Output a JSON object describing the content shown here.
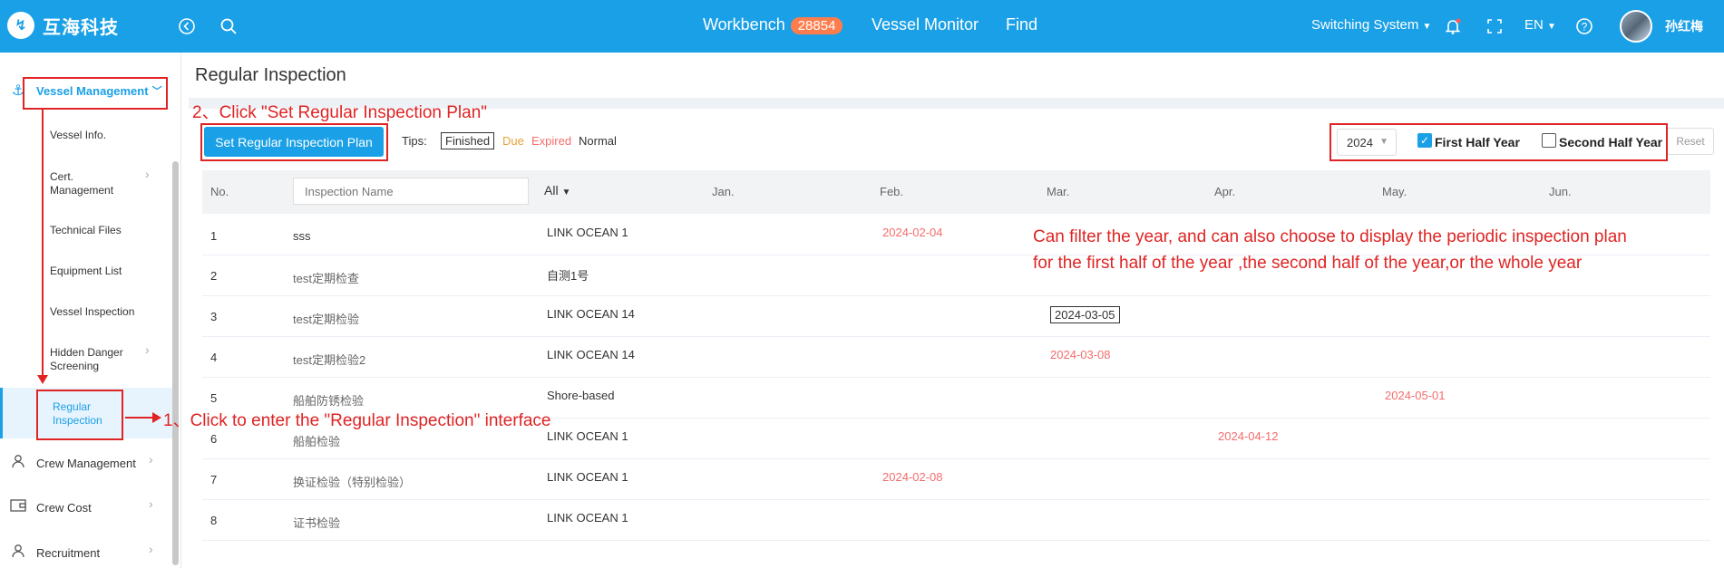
{
  "header": {
    "logo_text": "互海科技",
    "nav": {
      "workbench": "Workbench",
      "workbench_count": "28854",
      "vessel_monitor": "Vessel Monitor",
      "find": "Find"
    },
    "switching_system": "Switching System",
    "language": "EN",
    "user_name": "孙红梅"
  },
  "sidebar": {
    "vessel_management": "Vessel Management",
    "items": [
      {
        "label": "Vessel Info."
      },
      {
        "label": "Cert. Management"
      },
      {
        "label": "Technical Files"
      },
      {
        "label": "Equipment List"
      },
      {
        "label": "Vessel Inspection"
      },
      {
        "label": "Hidden Danger Screening"
      },
      {
        "label": "Regular Inspection"
      }
    ],
    "crew_management": "Crew Management",
    "crew_cost": "Crew Cost",
    "recruitment": "Recruitment"
  },
  "page": {
    "title": "Regular Inspection",
    "set_plan_button": "Set Regular Inspection Plan",
    "tips_label": "Tips:",
    "tips": {
      "finished": "Finished",
      "due": "Due",
      "expired": "Expired",
      "normal": "Normal"
    },
    "year": "2024",
    "first_half": "First Half Year",
    "first_half_checked": true,
    "second_half": "Second Half Year",
    "second_half_checked": false,
    "reset": "Reset"
  },
  "table": {
    "col_no": "No.",
    "name_placeholder": "Inspection Name",
    "vessel_filter": "All",
    "months": [
      "Jan.",
      "Feb.",
      "Mar.",
      "Apr.",
      "May.",
      "Jun."
    ],
    "rows": [
      {
        "no": "1",
        "name": "sss",
        "vessel": "LINK OCEAN 1",
        "date": "2024-02-04",
        "status": "expired"
      },
      {
        "no": "2",
        "name": "test定期检查",
        "vessel": "自测1号",
        "date": "",
        "status": ""
      },
      {
        "no": "3",
        "name": "test定期检验",
        "vessel": "LINK OCEAN 14",
        "date": "2024-03-05",
        "status": "finished"
      },
      {
        "no": "4",
        "name": "test定期检验2",
        "vessel": "LINK OCEAN 14",
        "date": "2024-03-08",
        "status": "expired"
      },
      {
        "no": "5",
        "name": "船舶防锈检验",
        "vessel": "Shore-based",
        "date": "2024-05-01",
        "status": "expired"
      },
      {
        "no": "6",
        "name": "船舶检验",
        "vessel": "LINK OCEAN 1",
        "date": "2024-04-12",
        "status": "expired"
      },
      {
        "no": "7",
        "name": "换证检验（特别检验）",
        "vessel": "LINK OCEAN 1",
        "date": "2024-02-08",
        "status": "expired"
      },
      {
        "no": "8",
        "name": "证书检验",
        "vessel": "LINK OCEAN 1",
        "date": "",
        "status": ""
      }
    ]
  },
  "annotations": {
    "step2": "2、Click \"Set Regular Inspection Plan\"",
    "step1": "1、Click to enter the \"Regular Inspection\" interface",
    "filter_note_line1": "Can filter the year, and can also choose to display the periodic inspection plan",
    "filter_note_line2": "for the first half of the year ,the second half of the year,or the whole year"
  }
}
